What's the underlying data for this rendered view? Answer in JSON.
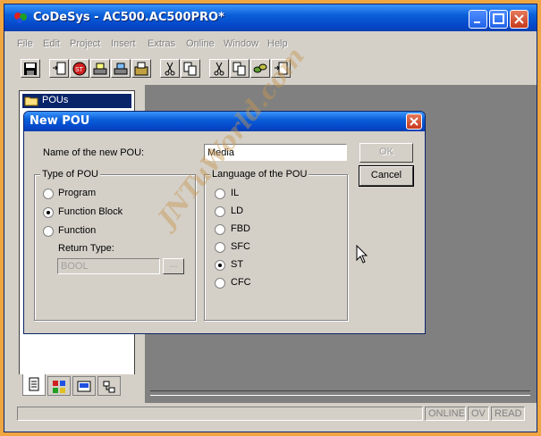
{
  "window": {
    "title": "CoDeSys - AC500.AC500PRO*"
  },
  "menu": [
    "File",
    "Edit",
    "Project",
    "Insert",
    "Extras",
    "Online",
    "Window",
    "Help"
  ],
  "panel": {
    "header": "POUs"
  },
  "status": {
    "online": "ONLINE",
    "ov": "OV",
    "read": "READ"
  },
  "dialog": {
    "title": "New POU",
    "name_label": "Name of the new POU:",
    "name_value": "Media",
    "ok_label": "OK",
    "cancel_label": "Cancel",
    "type_group": {
      "title": "Type of POU",
      "options": [
        "Program",
        "Function Block",
        "Function"
      ],
      "selected": "Function Block",
      "return_type_label": "Return Type:",
      "return_type_value": "BOOL",
      "browse_label": "..."
    },
    "language_group": {
      "title": "Language of the POU",
      "options": [
        "IL",
        "LD",
        "FBD",
        "SFC",
        "ST",
        "CFC"
      ],
      "selected": "ST"
    }
  },
  "watermark": "JNTuWorld.com",
  "colors": {
    "title_blue": "#0546c9",
    "frame_orange": "#f0a640",
    "workspace_gray": "#808080"
  }
}
